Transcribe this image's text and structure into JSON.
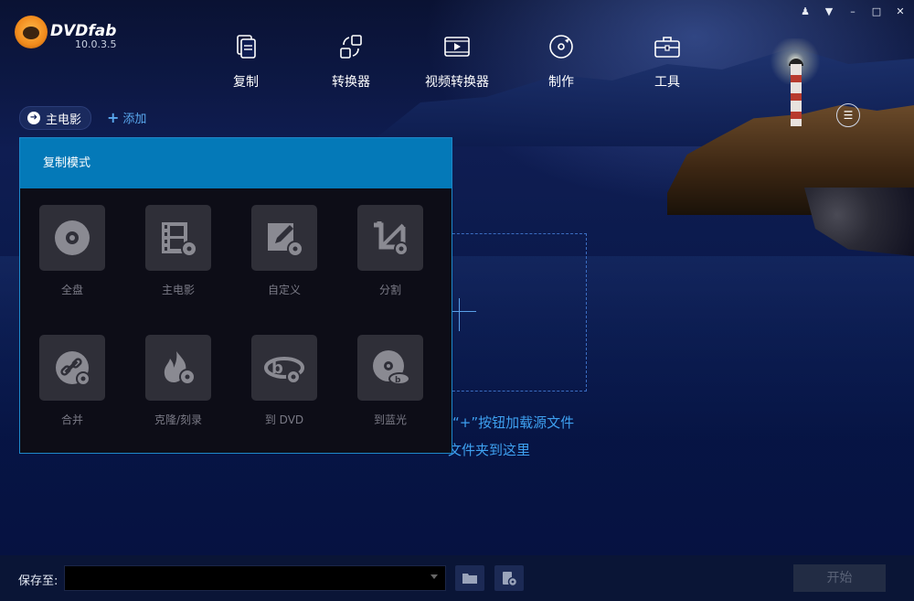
{
  "app": {
    "brand": "DVDfab",
    "version": "10.0.3.5"
  },
  "window_controls": [
    {
      "icon": "skin-icon",
      "glyph": "♟"
    },
    {
      "icon": "menu-down-icon",
      "glyph": "▼"
    },
    {
      "icon": "minimize-icon",
      "glyph": "–"
    },
    {
      "icon": "maximize-icon",
      "glyph": "□"
    },
    {
      "icon": "close-icon",
      "glyph": "✕"
    }
  ],
  "nav": [
    {
      "label": "复制",
      "icon": "copy-icon"
    },
    {
      "label": "转换器",
      "icon": "converter-icon"
    },
    {
      "label": "视频转换器",
      "icon": "video-converter-icon"
    },
    {
      "label": "制作",
      "icon": "creator-icon"
    },
    {
      "label": "工具",
      "icon": "toolbox-icon"
    }
  ],
  "toolbar": {
    "mode_label": "主电影",
    "add_label": "添加"
  },
  "panel": {
    "title": "复制模式",
    "modes": [
      {
        "label": "全盘",
        "icon": "full-disc-icon"
      },
      {
        "label": "主电影",
        "icon": "main-movie-icon"
      },
      {
        "label": "自定义",
        "icon": "customize-icon"
      },
      {
        "label": "分割",
        "icon": "split-icon"
      },
      {
        "label": "合并",
        "icon": "merge-icon"
      },
      {
        "label": "克隆/刻录",
        "icon": "clone-burn-icon"
      },
      {
        "label": "到 DVD",
        "icon": "to-dvd-icon"
      },
      {
        "label": "到蓝光",
        "icon": "to-bluray-icon"
      }
    ]
  },
  "drop": {
    "hint_line1": "击“+”按钮加载源文件",
    "hint_line2": "文件夹到这里"
  },
  "bottom": {
    "save_label": "保存至:",
    "save_value": "",
    "start_label": "开始"
  },
  "colors": {
    "accent": "#0479b8",
    "hint": "#3ea0f0",
    "tile": "#2f2f38"
  }
}
